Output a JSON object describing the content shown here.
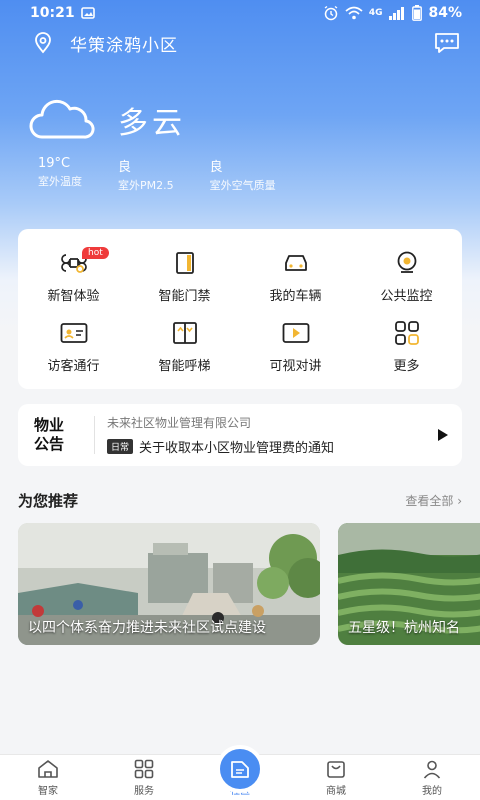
{
  "status_bar": {
    "time": "10:21",
    "network": "4G",
    "battery": "84%"
  },
  "header": {
    "title": "华策涂鸦小区"
  },
  "weather": {
    "condition": "多云",
    "stats": [
      {
        "value": "19°C",
        "label": "室外温度"
      },
      {
        "value": "良",
        "label": "室外PM2.5"
      },
      {
        "value": "良",
        "label": "室外空气质量"
      }
    ]
  },
  "services": [
    {
      "label": "新智体验",
      "icon": "command-icon",
      "badge": "hot"
    },
    {
      "label": "智能门禁",
      "icon": "door-icon"
    },
    {
      "label": "我的车辆",
      "icon": "car-icon"
    },
    {
      "label": "公共监控",
      "icon": "camera-icon"
    },
    {
      "label": "访客通行",
      "icon": "id-card-icon"
    },
    {
      "label": "智能呼梯",
      "icon": "elevator-icon"
    },
    {
      "label": "可视对讲",
      "icon": "video-icon"
    },
    {
      "label": "更多",
      "icon": "grid-icon"
    }
  ],
  "notice": {
    "title_line1": "物业",
    "title_line2": "公告",
    "company": "未来社区物业管理有限公司",
    "tag": "日常",
    "text": "关于收取本小区物业管理费的通知"
  },
  "recommend": {
    "title": "为您推荐",
    "more": "查看全部",
    "cards": [
      {
        "caption": "以四个体系奋力推进未来社区试点建设"
      },
      {
        "caption": "五星级！杭州知名"
      }
    ]
  },
  "tabbar": [
    {
      "label": "智家",
      "icon": "home-icon"
    },
    {
      "label": "服务",
      "icon": "apps-icon"
    },
    {
      "label": "社区",
      "icon": "community-icon",
      "active": true
    },
    {
      "label": "商城",
      "icon": "shop-icon"
    },
    {
      "label": "我的",
      "icon": "user-icon"
    }
  ],
  "colors": {
    "primary": "#4a8df2",
    "hot": "#ef3b3b"
  }
}
